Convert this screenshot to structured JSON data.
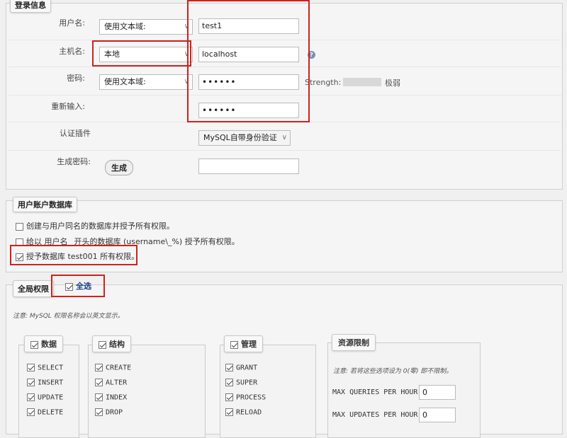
{
  "login": {
    "legend": "登录信息",
    "username_label": "用户名:",
    "username_type": "使用文本域:",
    "username_value": "test1",
    "host_label": "主机名:",
    "host_type": "本地",
    "host_value": "localhost",
    "password_label": "密码:",
    "password_type": "使用文本域:",
    "password_value": "••••••",
    "strength_label": "Strength:",
    "strength_value": "极弱",
    "retype_label": "重新输入:",
    "retype_value": "••••••",
    "auth_label": "认证插件",
    "auth_value": "MySQL自带身份验证",
    "generate_label": "生成密码:",
    "generate_button": "生成"
  },
  "database": {
    "legend": "用户账户数据库",
    "options": [
      {
        "label": "创建与用户同名的数据库并授予所有权限。",
        "checked": false
      },
      {
        "label": "给以 用户名_ 开头的数据库 (username\\_%) 授予所有权限。",
        "checked": false
      },
      {
        "label": "授予数据库 test001 所有权限。",
        "checked": true
      }
    ]
  },
  "global": {
    "legend": "全局权限",
    "select_all": "全选",
    "note": "注意:  MySQL 权限名称会以英文显示。",
    "groups": {
      "data": {
        "title": "数据",
        "items": [
          "SELECT",
          "INSERT",
          "UPDATE",
          "DELETE"
        ]
      },
      "structure": {
        "title": "结构",
        "items": [
          "CREATE",
          "ALTER",
          "INDEX",
          "DROP"
        ]
      },
      "admin": {
        "title": "管理",
        "items": [
          "GRANT",
          "SUPER",
          "PROCESS",
          "RELOAD"
        ]
      }
    },
    "limits": {
      "title": "资源限制",
      "note": "注意: 若将这些选项设为 0(零) 即不限制。",
      "max_queries_label": "MAX QUERIES PER HOUR",
      "max_queries_value": "0",
      "max_updates_label": "MAX UPDATES PER HOUR",
      "max_updates_value": "0"
    }
  },
  "colors": {
    "highlight": "#d0211c",
    "background": "#f0f0f0"
  }
}
